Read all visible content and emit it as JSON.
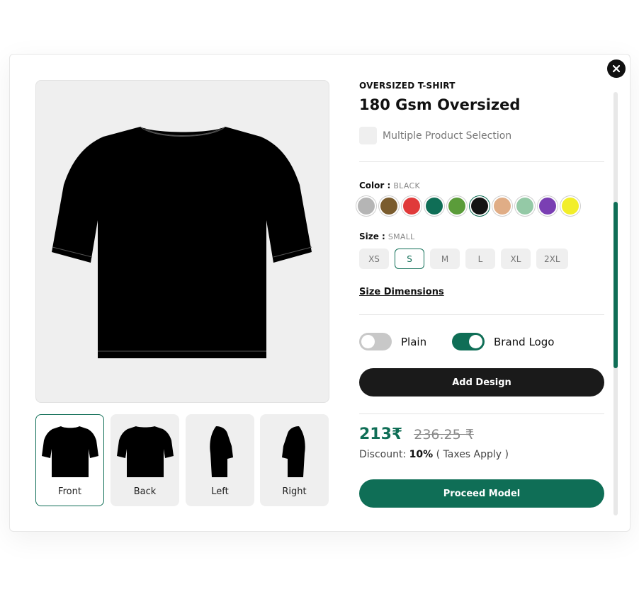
{
  "product": {
    "category": "OVERSIZED T-SHIRT",
    "name": "180 Gsm Oversized"
  },
  "multi_select": {
    "label": "Multiple Product Selection",
    "checked": false
  },
  "color": {
    "label": "Color :",
    "selected": "BLACK",
    "swatches": [
      "#b5b5b5",
      "#7a5c2e",
      "#e03a3a",
      "#0f6e56",
      "#5b9c3a",
      "#141414",
      "#e0ad86",
      "#94c9a6",
      "#7a3fb3",
      "#f2ee2a"
    ],
    "selected_index": 5
  },
  "size": {
    "label": "Size :",
    "selected": "SMALL",
    "options": [
      "XS",
      "S",
      "M",
      "L",
      "XL",
      "2XL"
    ],
    "selected_index": 1
  },
  "size_dimensions_label": "Size Dimensions",
  "toggles": [
    {
      "label": "Plain",
      "on": false
    },
    {
      "label": "Brand Logo",
      "on": true
    }
  ],
  "add_design_label": "Add Design",
  "pricing": {
    "price": "213₹",
    "original_price": "236.25 ₹",
    "discount_label": "Discount:",
    "discount_value": "10%",
    "discount_note": "( Taxes Apply )"
  },
  "proceed_label": "Proceed Model",
  "views": [
    {
      "label": "Front",
      "icon": "tshirt-front-icon"
    },
    {
      "label": "Back",
      "icon": "tshirt-back-icon"
    },
    {
      "label": "Left",
      "icon": "tshirt-left-icon"
    },
    {
      "label": "Right",
      "icon": "tshirt-right-icon"
    }
  ],
  "active_view_index": 0,
  "colors": {
    "accent": "#0f6e56",
    "dark": "#1a1a1a"
  }
}
